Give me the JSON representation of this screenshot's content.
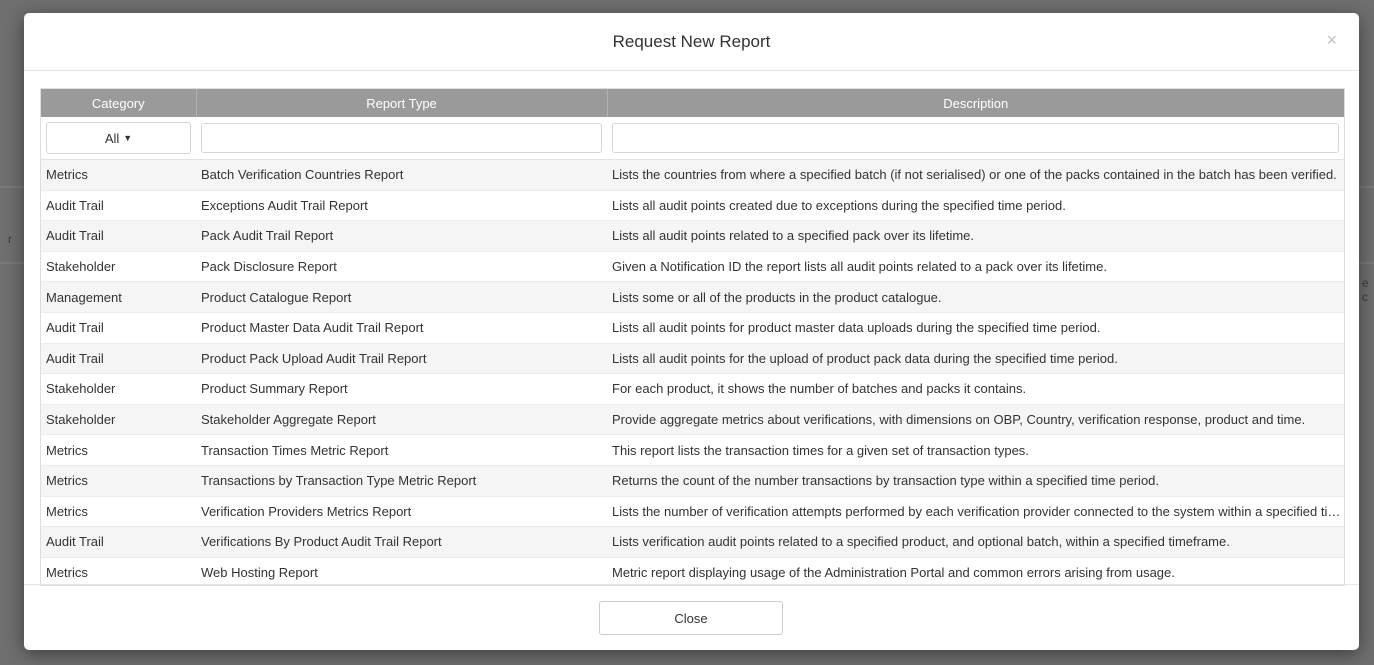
{
  "modal": {
    "title": "Request New Report",
    "close_icon": "×",
    "close_button": "Close"
  },
  "backdrop": {
    "left_char": "r",
    "right_char": "e c"
  },
  "table": {
    "columns": [
      "Category",
      "Report Type",
      "Description"
    ],
    "filters": {
      "category_selected": "All",
      "report_type_value": "",
      "description_value": ""
    },
    "rows": [
      {
        "category": "Metrics",
        "type": "Batch Verification Countries Report",
        "description": "Lists the countries from where a specified batch (if not serialised) or one of the packs contained in the batch has been verified."
      },
      {
        "category": "Audit Trail",
        "type": "Exceptions Audit Trail Report",
        "description": "Lists all audit points created due to exceptions during the specified time period."
      },
      {
        "category": "Audit Trail",
        "type": "Pack Audit Trail Report",
        "description": "Lists all audit points related to a specified pack over its lifetime."
      },
      {
        "category": "Stakeholder",
        "type": "Pack Disclosure Report",
        "description": "Given a Notification ID the report lists all audit points related to a pack over its lifetime."
      },
      {
        "category": "Management",
        "type": "Product Catalogue Report",
        "description": "Lists some or all of the products in the product catalogue."
      },
      {
        "category": "Audit Trail",
        "type": "Product Master Data Audit Trail Report",
        "description": "Lists all audit points for product master data uploads during the specified time period."
      },
      {
        "category": "Audit Trail",
        "type": "Product Pack Upload Audit Trail Report",
        "description": "Lists all audit points for the upload of product pack data during the specified time period."
      },
      {
        "category": "Stakeholder",
        "type": "Product Summary Report",
        "description": "For each product, it shows the number of batches and packs it contains."
      },
      {
        "category": "Stakeholder",
        "type": "Stakeholder Aggregate Report",
        "description": "Provide aggregate metrics about verifications, with dimensions on OBP, Country, verification response, product and time."
      },
      {
        "category": "Metrics",
        "type": "Transaction Times Metric Report",
        "description": "This report lists the transaction times for a given set of transaction types."
      },
      {
        "category": "Metrics",
        "type": "Transactions by Transaction Type Metric Report",
        "description": "Returns the count of the number transactions by transaction type within a specified time period."
      },
      {
        "category": "Metrics",
        "type": "Verification Providers Metrics Report",
        "description": "Lists the number of verification attempts performed by each verification provider connected to the system within a specified time period."
      },
      {
        "category": "Audit Trail",
        "type": "Verifications By Product Audit Trail Report",
        "description": "Lists verification audit points related to a specified product, and optional batch, within a specified timeframe."
      },
      {
        "category": "Metrics",
        "type": "Web Hosting Report",
        "description": "Metric report displaying usage of the Administration Portal and common errors arising from usage."
      }
    ]
  }
}
